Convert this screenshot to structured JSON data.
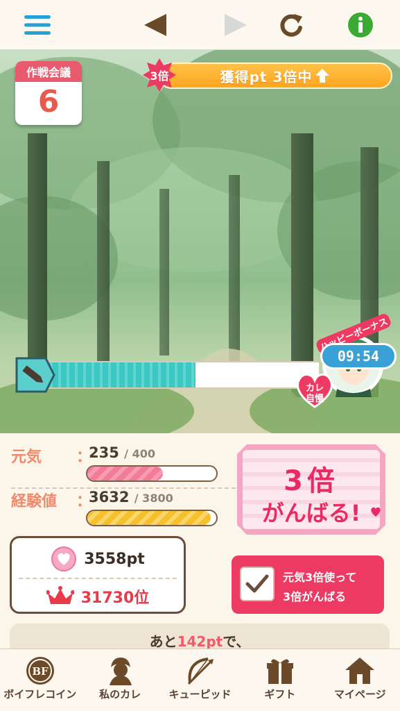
{
  "topbar": {
    "menu_icon": "hamburger-menu-icon",
    "back_icon": "triangle-left-icon",
    "forward_icon": "triangle-right-icon",
    "reload_icon": "reload-icon",
    "info_icon": "info-icon",
    "accent": "#27a0d8",
    "nav_color": "#6b4a2a",
    "info_color": "#3aaa35"
  },
  "meeting": {
    "label": "作戦会議",
    "count": "6"
  },
  "bonus_banner": {
    "multiplier": "3倍",
    "text": "獲得pt 3倍中"
  },
  "progress": {
    "fraction": 0.55
  },
  "happy_bonus": {
    "title": "ハッピーボーナス",
    "badge_line1": "カレ",
    "badge_line2": "自慢",
    "timer": "09:54"
  },
  "stats": {
    "energy": {
      "label": "元気",
      "colon": "：",
      "value": "235",
      "max": "/ 400",
      "fraction": 0.5875,
      "color": "#f27b99"
    },
    "exp": {
      "label": "経験値",
      "colon": "：",
      "value": "3632",
      "max": "/ 3800",
      "fraction": 0.9558,
      "color": "#f5c02c"
    }
  },
  "points": {
    "value": "3558pt",
    "rank": "31730位",
    "rank_color": "#e83a4b"
  },
  "triple_card": {
    "line1": "3倍",
    "line2": "がんばる!"
  },
  "triple_option": {
    "line1": "元気3倍使って",
    "line2": "3倍がんばる",
    "checked": true
  },
  "note": {
    "prefix": "あと",
    "highlight": "142pt",
    "suffix": "で、"
  },
  "tabs": [
    {
      "label": "ボイフレコイン",
      "icon": "coin-icon"
    },
    {
      "label": "私のカレ",
      "icon": "boyfriend-icon"
    },
    {
      "label": "キューピッド",
      "icon": "cupid-bow-icon"
    },
    {
      "label": "ギフト",
      "icon": "gift-icon"
    },
    {
      "label": "マイページ",
      "icon": "home-icon"
    }
  ]
}
